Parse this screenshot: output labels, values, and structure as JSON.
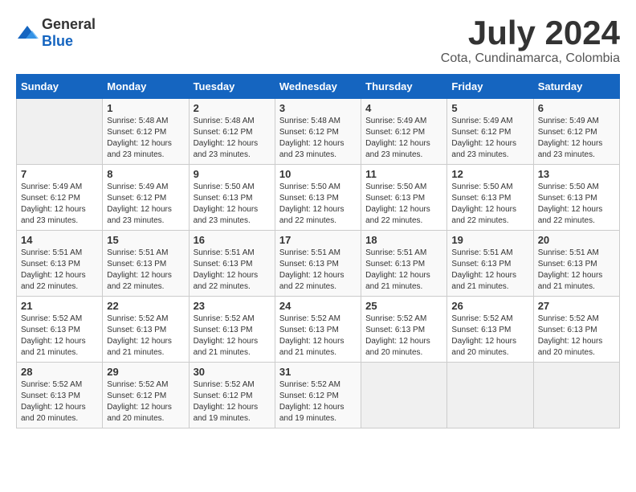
{
  "header": {
    "logo": {
      "general": "General",
      "blue": "Blue"
    },
    "title": "July 2024",
    "location": "Cota, Cundinamarca, Colombia"
  },
  "weekdays": [
    "Sunday",
    "Monday",
    "Tuesday",
    "Wednesday",
    "Thursday",
    "Friday",
    "Saturday"
  ],
  "weeks": [
    [
      {
        "day": "",
        "sunrise": "",
        "sunset": "",
        "daylight": ""
      },
      {
        "day": "1",
        "sunrise": "Sunrise: 5:48 AM",
        "sunset": "Sunset: 6:12 PM",
        "daylight": "Daylight: 12 hours and 23 minutes."
      },
      {
        "day": "2",
        "sunrise": "Sunrise: 5:48 AM",
        "sunset": "Sunset: 6:12 PM",
        "daylight": "Daylight: 12 hours and 23 minutes."
      },
      {
        "day": "3",
        "sunrise": "Sunrise: 5:48 AM",
        "sunset": "Sunset: 6:12 PM",
        "daylight": "Daylight: 12 hours and 23 minutes."
      },
      {
        "day": "4",
        "sunrise": "Sunrise: 5:49 AM",
        "sunset": "Sunset: 6:12 PM",
        "daylight": "Daylight: 12 hours and 23 minutes."
      },
      {
        "day": "5",
        "sunrise": "Sunrise: 5:49 AM",
        "sunset": "Sunset: 6:12 PM",
        "daylight": "Daylight: 12 hours and 23 minutes."
      },
      {
        "day": "6",
        "sunrise": "Sunrise: 5:49 AM",
        "sunset": "Sunset: 6:12 PM",
        "daylight": "Daylight: 12 hours and 23 minutes."
      }
    ],
    [
      {
        "day": "7",
        "sunrise": "Sunrise: 5:49 AM",
        "sunset": "Sunset: 6:12 PM",
        "daylight": "Daylight: 12 hours and 23 minutes."
      },
      {
        "day": "8",
        "sunrise": "Sunrise: 5:49 AM",
        "sunset": "Sunset: 6:12 PM",
        "daylight": "Daylight: 12 hours and 23 minutes."
      },
      {
        "day": "9",
        "sunrise": "Sunrise: 5:50 AM",
        "sunset": "Sunset: 6:13 PM",
        "daylight": "Daylight: 12 hours and 23 minutes."
      },
      {
        "day": "10",
        "sunrise": "Sunrise: 5:50 AM",
        "sunset": "Sunset: 6:13 PM",
        "daylight": "Daylight: 12 hours and 22 minutes."
      },
      {
        "day": "11",
        "sunrise": "Sunrise: 5:50 AM",
        "sunset": "Sunset: 6:13 PM",
        "daylight": "Daylight: 12 hours and 22 minutes."
      },
      {
        "day": "12",
        "sunrise": "Sunrise: 5:50 AM",
        "sunset": "Sunset: 6:13 PM",
        "daylight": "Daylight: 12 hours and 22 minutes."
      },
      {
        "day": "13",
        "sunrise": "Sunrise: 5:50 AM",
        "sunset": "Sunset: 6:13 PM",
        "daylight": "Daylight: 12 hours and 22 minutes."
      }
    ],
    [
      {
        "day": "14",
        "sunrise": "Sunrise: 5:51 AM",
        "sunset": "Sunset: 6:13 PM",
        "daylight": "Daylight: 12 hours and 22 minutes."
      },
      {
        "day": "15",
        "sunrise": "Sunrise: 5:51 AM",
        "sunset": "Sunset: 6:13 PM",
        "daylight": "Daylight: 12 hours and 22 minutes."
      },
      {
        "day": "16",
        "sunrise": "Sunrise: 5:51 AM",
        "sunset": "Sunset: 6:13 PM",
        "daylight": "Daylight: 12 hours and 22 minutes."
      },
      {
        "day": "17",
        "sunrise": "Sunrise: 5:51 AM",
        "sunset": "Sunset: 6:13 PM",
        "daylight": "Daylight: 12 hours and 22 minutes."
      },
      {
        "day": "18",
        "sunrise": "Sunrise: 5:51 AM",
        "sunset": "Sunset: 6:13 PM",
        "daylight": "Daylight: 12 hours and 21 minutes."
      },
      {
        "day": "19",
        "sunrise": "Sunrise: 5:51 AM",
        "sunset": "Sunset: 6:13 PM",
        "daylight": "Daylight: 12 hours and 21 minutes."
      },
      {
        "day": "20",
        "sunrise": "Sunrise: 5:51 AM",
        "sunset": "Sunset: 6:13 PM",
        "daylight": "Daylight: 12 hours and 21 minutes."
      }
    ],
    [
      {
        "day": "21",
        "sunrise": "Sunrise: 5:52 AM",
        "sunset": "Sunset: 6:13 PM",
        "daylight": "Daylight: 12 hours and 21 minutes."
      },
      {
        "day": "22",
        "sunrise": "Sunrise: 5:52 AM",
        "sunset": "Sunset: 6:13 PM",
        "daylight": "Daylight: 12 hours and 21 minutes."
      },
      {
        "day": "23",
        "sunrise": "Sunrise: 5:52 AM",
        "sunset": "Sunset: 6:13 PM",
        "daylight": "Daylight: 12 hours and 21 minutes."
      },
      {
        "day": "24",
        "sunrise": "Sunrise: 5:52 AM",
        "sunset": "Sunset: 6:13 PM",
        "daylight": "Daylight: 12 hours and 21 minutes."
      },
      {
        "day": "25",
        "sunrise": "Sunrise: 5:52 AM",
        "sunset": "Sunset: 6:13 PM",
        "daylight": "Daylight: 12 hours and 20 minutes."
      },
      {
        "day": "26",
        "sunrise": "Sunrise: 5:52 AM",
        "sunset": "Sunset: 6:13 PM",
        "daylight": "Daylight: 12 hours and 20 minutes."
      },
      {
        "day": "27",
        "sunrise": "Sunrise: 5:52 AM",
        "sunset": "Sunset: 6:13 PM",
        "daylight": "Daylight: 12 hours and 20 minutes."
      }
    ],
    [
      {
        "day": "28",
        "sunrise": "Sunrise: 5:52 AM",
        "sunset": "Sunset: 6:13 PM",
        "daylight": "Daylight: 12 hours and 20 minutes."
      },
      {
        "day": "29",
        "sunrise": "Sunrise: 5:52 AM",
        "sunset": "Sunset: 6:12 PM",
        "daylight": "Daylight: 12 hours and 20 minutes."
      },
      {
        "day": "30",
        "sunrise": "Sunrise: 5:52 AM",
        "sunset": "Sunset: 6:12 PM",
        "daylight": "Daylight: 12 hours and 19 minutes."
      },
      {
        "day": "31",
        "sunrise": "Sunrise: 5:52 AM",
        "sunset": "Sunset: 6:12 PM",
        "daylight": "Daylight: 12 hours and 19 minutes."
      },
      {
        "day": "",
        "sunrise": "",
        "sunset": "",
        "daylight": ""
      },
      {
        "day": "",
        "sunrise": "",
        "sunset": "",
        "daylight": ""
      },
      {
        "day": "",
        "sunrise": "",
        "sunset": "",
        "daylight": ""
      }
    ]
  ]
}
